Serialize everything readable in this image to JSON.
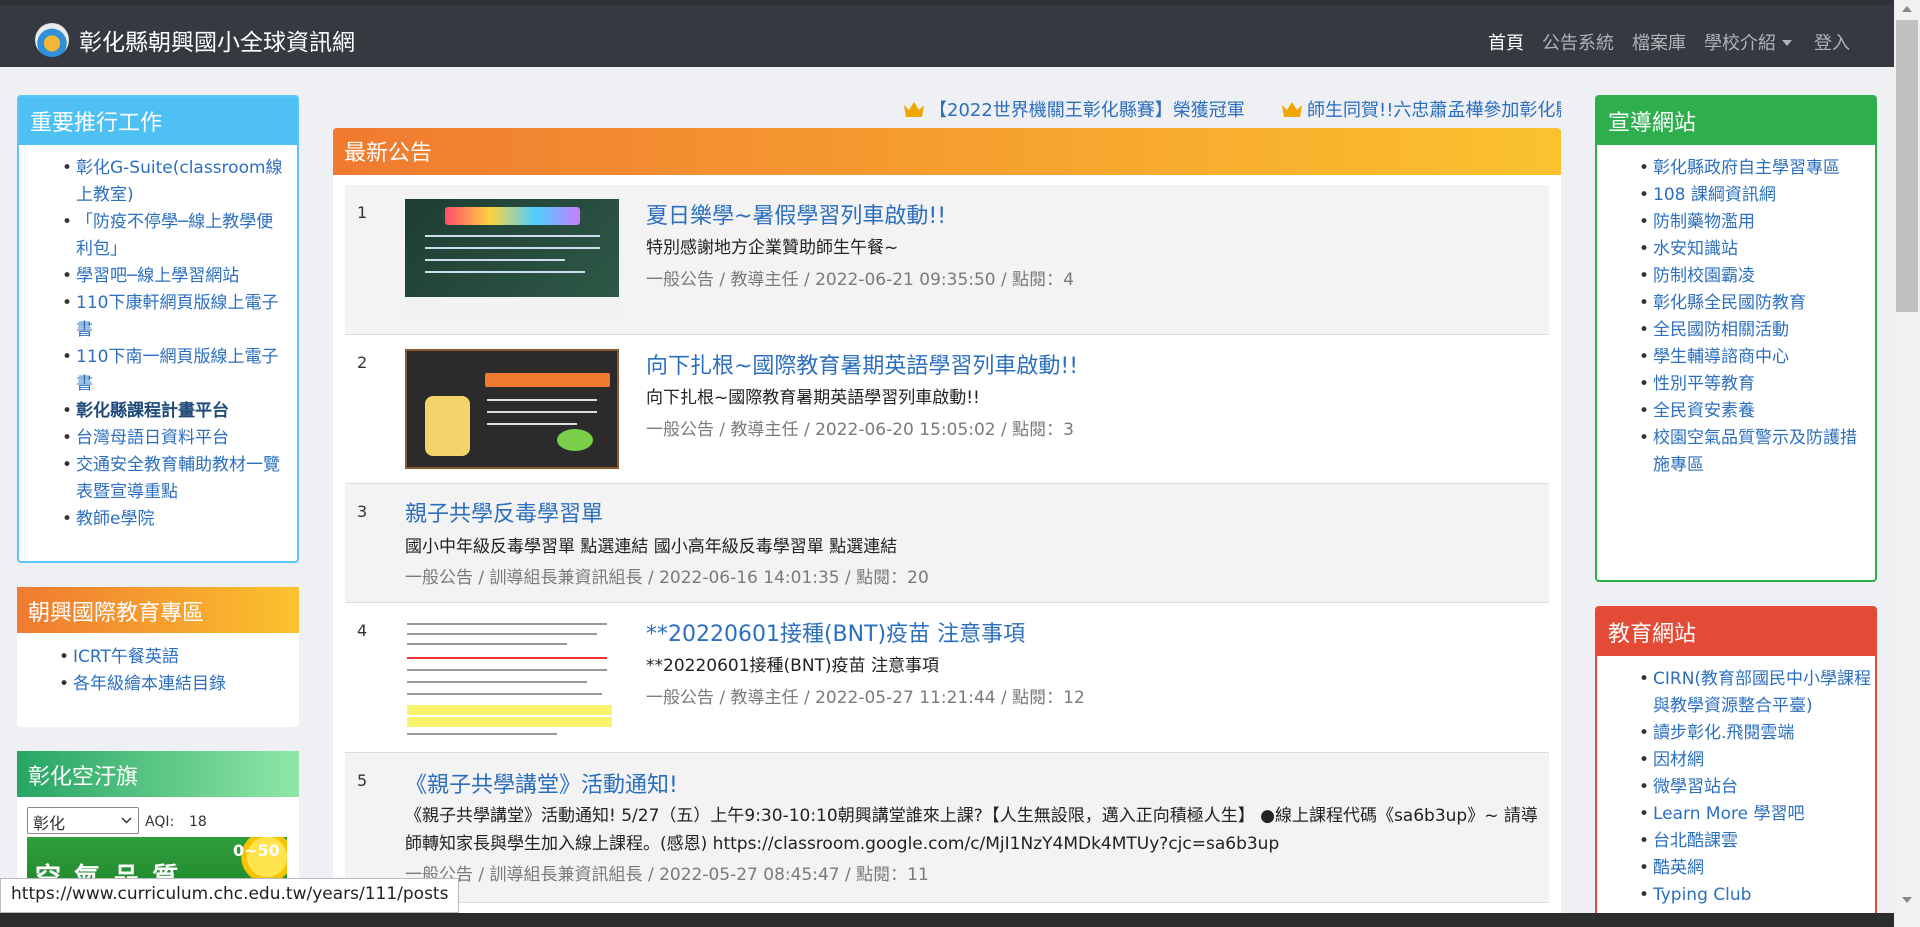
{
  "brand": "彰化縣朝興國小全球資訊網",
  "nav": {
    "home": "首頁",
    "announce": "公告系統",
    "files": "檔案庫",
    "intro": "學校介紹",
    "login": "登入"
  },
  "left": {
    "important": {
      "title": "重要推行工作",
      "items": [
        "彰化G-Suite(classroom線上教室)",
        "「防疫不停學─線上教學便利包」",
        "學習吧─線上學習網站",
        "110下康軒網頁版線上電子書",
        "110下南一網頁版線上電子書",
        "彰化縣課程計畫平台",
        "台灣母語日資料平台",
        "交通安全教育輔助教材一覽表暨宣導重點",
        "教師e學院"
      ]
    },
    "intl": {
      "title": "朝興國際教育專區",
      "items": [
        "ICRT午餐英語",
        "各年級繪本連結目錄"
      ]
    },
    "air": {
      "title": "彰化空汙旗",
      "select": "彰化",
      "aqi_label": "AQI:",
      "aqi_value": "18",
      "banner_text": "空 氣 品 質",
      "banner_range": "0~50"
    }
  },
  "marquee": {
    "item1": "【2022世界機關王彰化縣賽】榮獲冠軍",
    "item2": "師生同賀!!六忠蕭孟樺參加彰化縣"
  },
  "announcements": {
    "title": "最新公告",
    "items": [
      {
        "num": "1",
        "title": "夏日樂學~暑假學習列車啟動!!",
        "desc": "特別感謝地方企業贊助師生午餐~",
        "meta": "一般公告 / 教導主任 / 2022-06-21 09:35:50 / 點閱：4"
      },
      {
        "num": "2",
        "title": "向下扎根~國際教育暑期英語學習列車啟動!!",
        "desc": "向下扎根~國際教育暑期英語學習列車啟動!!",
        "meta": "一般公告 / 教導主任 / 2022-06-20 15:05:02 / 點閱：3"
      },
      {
        "num": "3",
        "title": "親子共學反毒學習單",
        "desc": "國小中年級反毒學習單 點選連結 國小高年級反毒學習單 點選連結",
        "meta": "一般公告 / 訓導組長兼資訊組長 / 2022-06-16 14:01:35 / 點閱：20"
      },
      {
        "num": "4",
        "title": "**20220601接種(BNT)疫苗 注意事項",
        "desc": "**20220601接種(BNT)疫苗 注意事項",
        "meta": "一般公告 / 教導主任 / 2022-05-27 11:21:44 / 點閱：12"
      },
      {
        "num": "5",
        "title": "《親子共學講堂》活動通知!",
        "desc": "《親子共學講堂》活動通知! 5/27（五）上午9:30-10:10朝興講堂誰來上課?【人生無設限，邁入正向積極人生】 ●線上課程代碼《sa6b3up》~ 請導師轉知家長與學生加入線上課程。(感恩) https://classroom.google.com/c/MjI1NzY4MDk4MTUy?cjc=sa6b3up",
        "meta": "一般公告 / 訓導組長兼資訊組長 / 2022-05-27 08:45:47 / 點閱：11"
      }
    ]
  },
  "right": {
    "promo": {
      "title": "宣導網站",
      "items": [
        "彰化縣政府自主學習專區",
        "108 課綱資訊網",
        "防制藥物濫用",
        "水安知識站",
        "防制校園霸凌",
        "彰化縣全民國防教育",
        "全民國防相關活動",
        "學生輔導諮商中心",
        "性別平等教育",
        "全民資安素養",
        "校園空氣品質警示及防護措施專區"
      ]
    },
    "edu": {
      "title": "教育網站",
      "items": [
        "CIRN(教育部國民中小學課程與教學資源整合平臺)",
        "讀步彰化.飛閱雲端",
        "因材網",
        "微學習站台",
        "Learn More 學習吧",
        "台北酷課雲",
        "酷英網",
        "Typing Club"
      ]
    }
  },
  "status_url": "https://www.curriculum.chc.edu.tw/years/111/posts"
}
